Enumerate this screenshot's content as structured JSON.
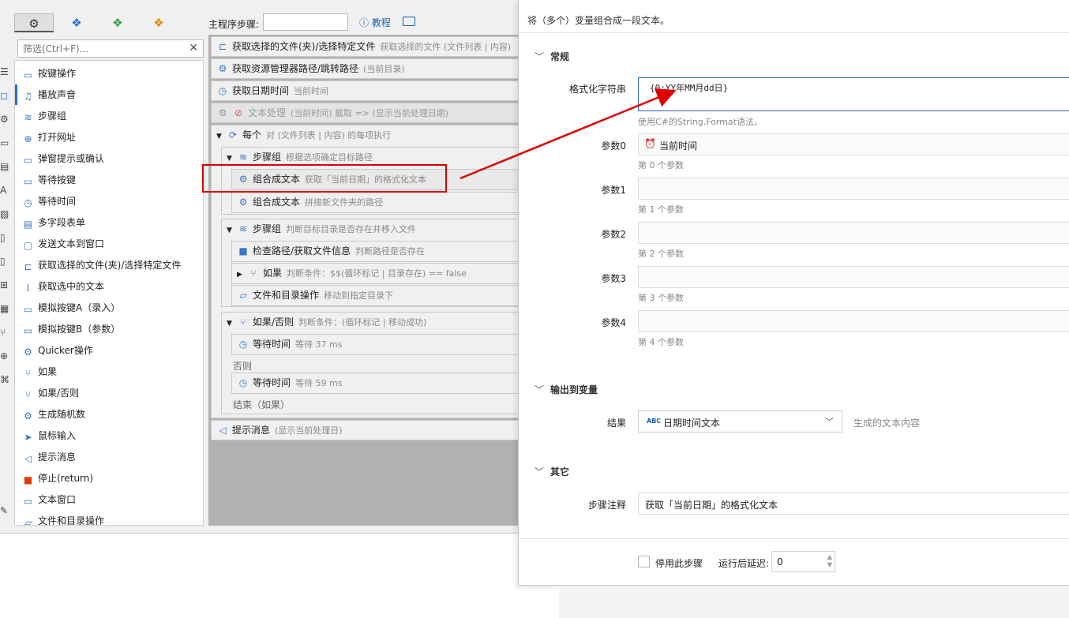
{
  "tabs": [
    {
      "icon": "gears-icon"
    },
    {
      "icon": "cubes-blue-icon"
    },
    {
      "icon": "cubes-green-icon"
    },
    {
      "icon": "cubes-orange-icon"
    }
  ],
  "filter": {
    "placeholder": "筛选(Ctrl+F)..."
  },
  "actions": [
    {
      "label": "按键操作",
      "icon": "keyboard-icon"
    },
    {
      "label": "播放声音",
      "icon": "music-icon"
    },
    {
      "label": "步骤组",
      "icon": "layers-icon"
    },
    {
      "label": "打开网址",
      "icon": "globe-icon"
    },
    {
      "label": "弹窗提示或确认",
      "icon": "window-icon"
    },
    {
      "label": "等待按键",
      "icon": "keyboard-icon"
    },
    {
      "label": "等待时间",
      "icon": "timer-icon"
    },
    {
      "label": "多字段表单",
      "icon": "form-icon"
    },
    {
      "label": "发送文本到窗口",
      "icon": "message-icon"
    },
    {
      "label": "获取选择的文件(夹)/选择特定文件",
      "icon": "file-tree-icon"
    },
    {
      "label": "获取选中的文本",
      "icon": "text-cursor-icon"
    },
    {
      "label": "模拟按键A（录入）",
      "icon": "keyboard-icon"
    },
    {
      "label": "模拟按键B（参数）",
      "icon": "keyboard-icon"
    },
    {
      "label": "Quicker操作",
      "icon": "gear-icon"
    },
    {
      "label": "如果",
      "icon": "branch-icon"
    },
    {
      "label": "如果/否则",
      "icon": "branch-icon"
    },
    {
      "label": "生成随机数",
      "icon": "gear-icon"
    },
    {
      "label": "鼠标输入",
      "icon": "cursor-icon"
    },
    {
      "label": "提示消息",
      "icon": "megaphone-icon"
    },
    {
      "label": "停止(return)",
      "icon": "stop-icon"
    },
    {
      "label": "文本窗口",
      "icon": "window-icon"
    },
    {
      "label": "文件和目录操作",
      "icon": "folder-icon"
    }
  ],
  "header": {
    "steps_label": "主程序步骤:",
    "tutorial": "教程"
  },
  "steps": {
    "s1": {
      "title": "获取选择的文件(夹)/选择特定文件",
      "note": "获取选择的文件 (文件列表 | 内容)"
    },
    "s2": {
      "title": "获取资源管理器路径/跳转路径",
      "note": "(当前目录)"
    },
    "s3": {
      "title": "获取日期时间",
      "note": "当前时间"
    },
    "s4": {
      "title": "文本处理",
      "note": "(当前时间) 截取 => (显示当前处理日期)"
    },
    "s5": {
      "title": "每个",
      "note": "对 (文件列表 | 内容) 的每项执行"
    },
    "s6": {
      "title": "步骤组",
      "note": "根据选项确定目标路径"
    },
    "s7": {
      "title": "组合成文本",
      "note": "获取「当前日期」的格式化文本"
    },
    "s8": {
      "title": "组合成文本",
      "note": "拼接新文件夹的路径"
    },
    "s9": {
      "title": "步骤组",
      "note": "判断目标目录是否存在并移入文件"
    },
    "s10": {
      "title": "检查路径/获取文件信息",
      "note": "判断路径是否存在"
    },
    "s11": {
      "title": "如果",
      "note": "判断条件：$$(循环标记 | 目录存在) == false"
    },
    "s12": {
      "title": "文件和目录操作",
      "note": "移动到指定目录下"
    },
    "s13": {
      "title": "如果/否则",
      "note": "判断条件：(循环标记 | 移动成功)"
    },
    "s14": {
      "title": "等待时间",
      "note": "等待 37 ms"
    },
    "else_label": "否则",
    "s15": {
      "title": "等待时间",
      "note": "等待 59 ms"
    },
    "end_label": "结束（如果）",
    "s16": {
      "title": "提示消息",
      "note": "(显示当前处理日)"
    }
  },
  "dialog": {
    "description": "将（多个）变量组合成一段文本。",
    "section_general": "常规",
    "format_label": "格式化字符串",
    "format_value": "{0:YY年MM月dd日}",
    "format_hint": "使用C#的String.Format语法。",
    "params": [
      {
        "label": "参数0",
        "value": "当前时间",
        "hint": "第 0 个参数"
      },
      {
        "label": "参数1",
        "value": "",
        "hint": "第 1 个参数"
      },
      {
        "label": "参数2",
        "value": "",
        "hint": "第 2 个参数"
      },
      {
        "label": "参数3",
        "value": "",
        "hint": "第 3 个参数"
      },
      {
        "label": "参数4",
        "value": "",
        "hint": "第 4 个参数"
      }
    ],
    "section_output": "输出到变量",
    "result_label": "结果",
    "result_type": "ABC",
    "result_value": "日期时间文本",
    "result_hint": "生成的文本内容",
    "section_other": "其它",
    "note_label": "步骤注释",
    "note_value": "获取「当前日期」的格式化文本",
    "disable_label": "停用此步骤",
    "delay_label": "运行后延迟:",
    "delay_value": "0"
  },
  "colors": {
    "accent": "#2e63c7",
    "highlight": "#e00000",
    "steps_bg": "#b2b2b2"
  }
}
